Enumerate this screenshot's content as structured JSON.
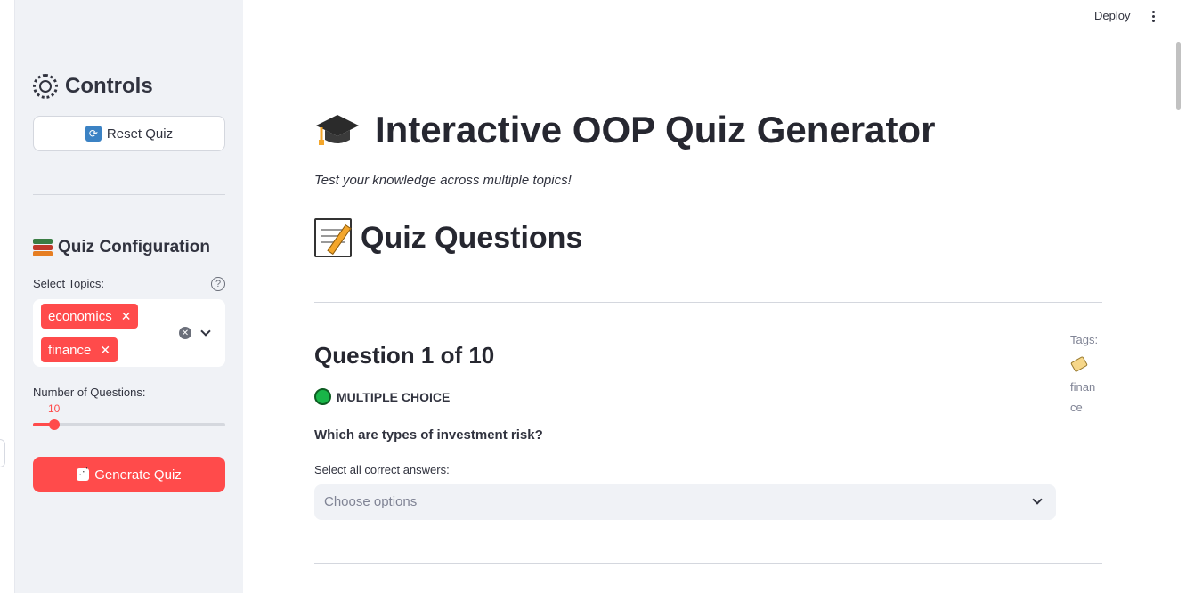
{
  "topbar": {
    "deploy_label": "Deploy"
  },
  "sidebar": {
    "controls_title": "Controls",
    "reset_label": "Reset Quiz",
    "config_title": "Quiz Configuration",
    "topics_label": "Select Topics:",
    "topics_selected": [
      "economics",
      "finance"
    ],
    "num_questions_label": "Number of Questions:",
    "num_questions_value": "10",
    "slider_fraction": 0.11,
    "generate_label": "Generate Quiz"
  },
  "main": {
    "title": "Interactive OOP Quiz Generator",
    "subtitle": "Test your knowledge across multiple topics!",
    "section_title": "Quiz Questions",
    "question": {
      "heading": "Question 1 of 10",
      "type": "MULTIPLE CHOICE",
      "text": "Which are types of investment risk?",
      "answers_label": "Select all correct answers:",
      "placeholder": "Choose options"
    },
    "tags": {
      "label": "Tags:",
      "line1": "finan",
      "line2": "ce"
    }
  },
  "colors": {
    "accent": "#ff4b4b",
    "sidebar_bg": "#f0f2f6",
    "text": "#31333f"
  },
  "icons": [
    "gear-icon",
    "reset-icon",
    "books-icon",
    "help-icon",
    "close-icon",
    "chevron-down-icon",
    "dice-icon",
    "graduation-cap-icon",
    "memo-icon",
    "green-circle-icon",
    "tag-icon",
    "kebab-menu-icon"
  ]
}
